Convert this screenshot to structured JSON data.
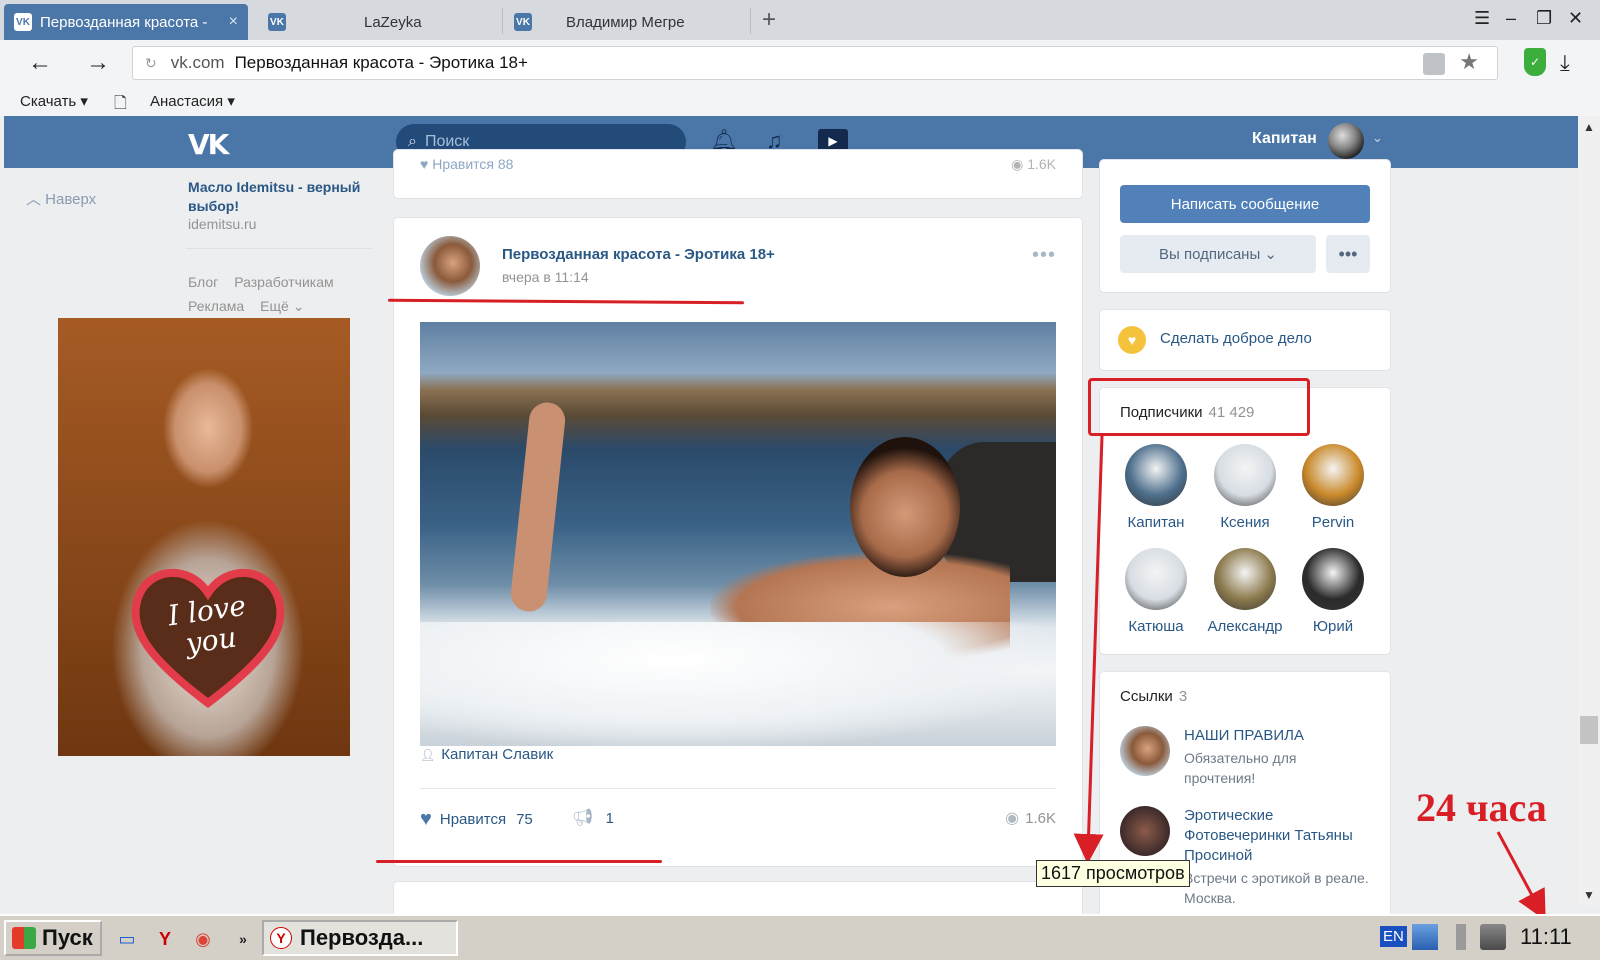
{
  "browser": {
    "tabs": [
      {
        "title": "Первозданная красота - ",
        "badge": "VK",
        "active": true,
        "close": "×"
      },
      {
        "title": "LaZeyka",
        "badge": "VK",
        "active": false
      },
      {
        "title": "Владимир Мегре",
        "badge": "VK",
        "active": false
      }
    ],
    "new_tab": "+",
    "url_domain": "vk.com",
    "url_title": "Первозданная красота - Эротика 18+",
    "bookmarks": [
      {
        "label": "Скачать ▾"
      },
      {
        "label": "Анастасия ▾"
      }
    ]
  },
  "vk_header": {
    "logo": "VK",
    "search_placeholder": "Поиск",
    "user_name": "Капитан"
  },
  "left": {
    "back_to_top": "Наверх",
    "ad_title": "Масло Idemitsu - верный выбор!",
    "ad_domain": "idemitsu.ru",
    "footer_links": [
      "Блог",
      "Разработчикам",
      "Реклама",
      "Ещё ⌄"
    ],
    "ad_image_text": "I love you"
  },
  "feed": {
    "prev_post": {
      "likes_label": "Нравится",
      "likes": "88",
      "views": "1.6K"
    },
    "post": {
      "author": "Первозданная красота - Эротика 18+",
      "time": "вчера в 11:14",
      "signer": "Капитан Славик",
      "like_label": "Нравится",
      "likes": "75",
      "shares": "1",
      "views": "1.6K"
    }
  },
  "right": {
    "write_message": "Написать сообщение",
    "subscribed": "Вы подписаны ⌄",
    "more": "•••",
    "good_deed": "Сделать доброе дело",
    "subscribers_label": "Подписчики",
    "subscribers_count": "41 429",
    "subscribers": [
      {
        "name": "Капитан",
        "color": "#4d6f8c"
      },
      {
        "name": "Ксения",
        "color": "#d7dde3"
      },
      {
        "name": "Pervin",
        "color": "#c9892a"
      },
      {
        "name": "Катюша",
        "color": "#d7dde3"
      },
      {
        "name": "Александр",
        "color": "#8c7a4d"
      },
      {
        "name": "Юрий",
        "color": "#2b2b2b"
      }
    ],
    "links_label": "Ссылки",
    "links_count": "3",
    "links": [
      {
        "title": "НАШИ ПРАВИЛА",
        "desc": "Обязательно для прочтения!"
      },
      {
        "title": "Эротические Фотовечеринки Татьяны Просиной",
        "desc": "Встречи с эротикой в реале. Москва."
      }
    ]
  },
  "annotations": {
    "tooltip": "1617 просмотров",
    "label_24h": "24 часа",
    "color": "#d81f26"
  },
  "taskbar": {
    "start": "Пуск",
    "task": "Первозда...",
    "lang": "EN",
    "clock": "11:11"
  }
}
